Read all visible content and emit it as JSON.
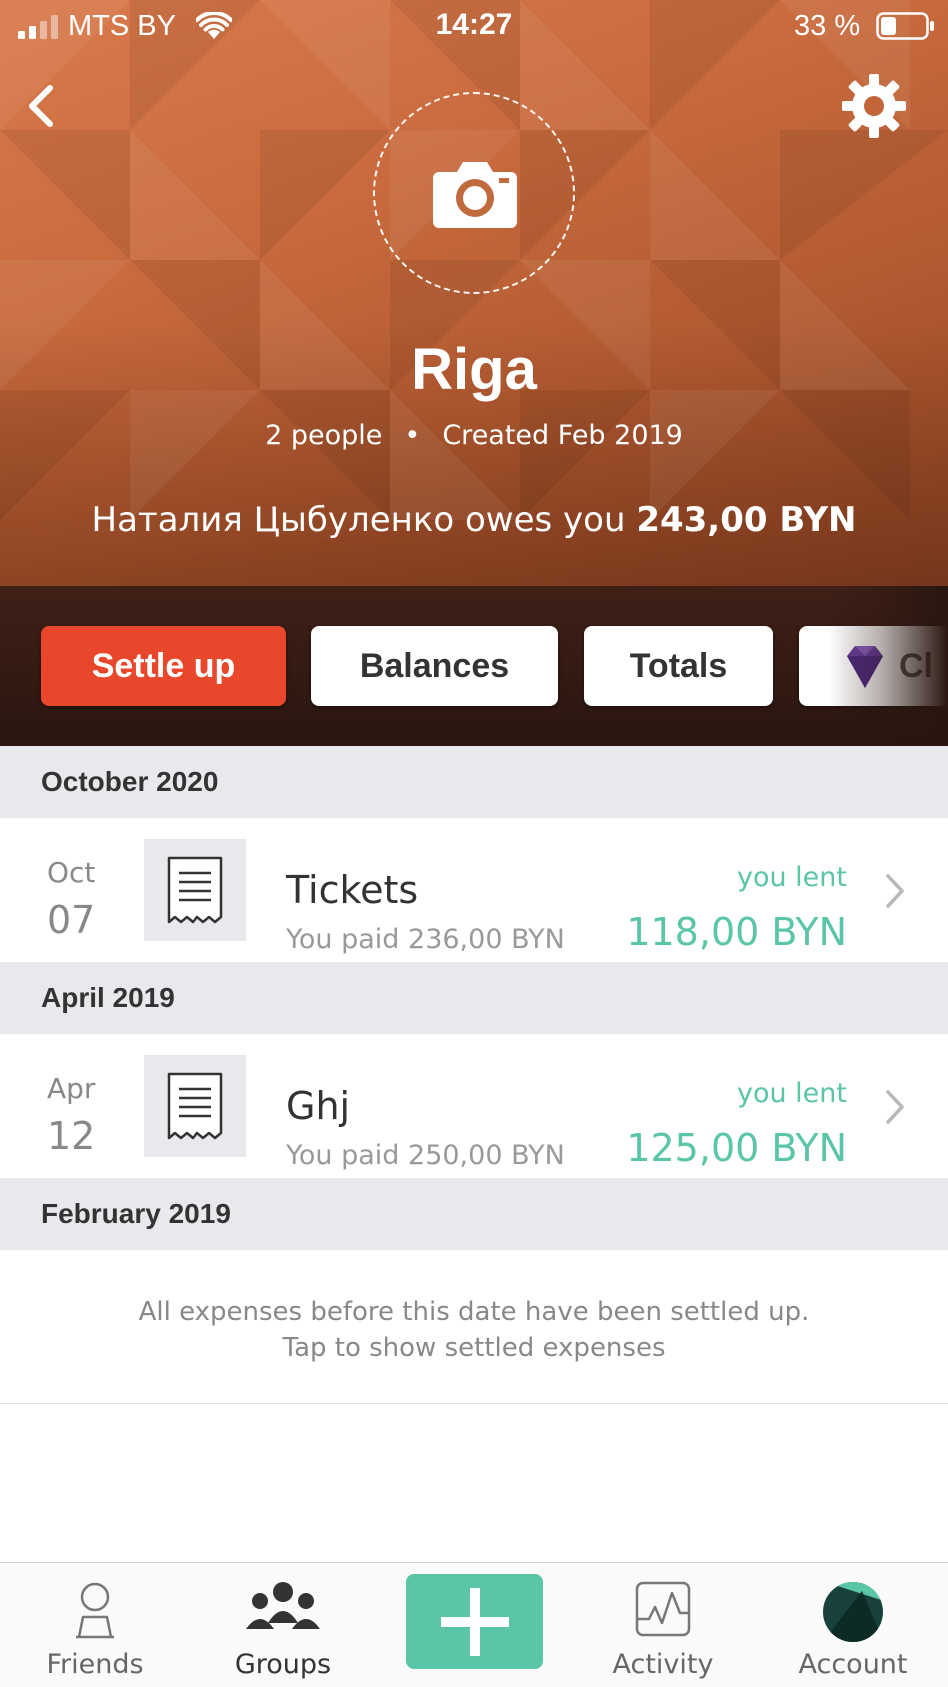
{
  "status_bar": {
    "carrier": "MTS BY",
    "time": "14:27",
    "battery_pct": "33 %"
  },
  "colors": {
    "accent": "#5bc5a7",
    "settle": "#e8472b",
    "header_bg": "#c86a3d"
  },
  "icons": [
    "back-arrow",
    "gear",
    "camera",
    "receipt",
    "chevron-right",
    "person",
    "group",
    "plus",
    "activity-chart",
    "account-avatar",
    "gem"
  ],
  "group": {
    "name": "Riga",
    "people": "2 people",
    "created": "Created Feb 2019",
    "owes_text": "Наталия Цыбуленко owes you",
    "owes_amount": "243,00 BYN"
  },
  "actions": {
    "settle_up": "Settle up",
    "balances": "Balances",
    "totals": "Totals",
    "charts": "Cl"
  },
  "sections": [
    {
      "header": "October 2020",
      "expense": {
        "month": "Oct",
        "day": "07",
        "title": "Tickets",
        "paid": "You paid 236,00 BYN",
        "lent_label": "you lent",
        "lent_amount": "118,00 BYN"
      }
    },
    {
      "header": "April 2019",
      "expense": {
        "month": "Apr",
        "day": "12",
        "title": "Ghj",
        "paid": "You paid 250,00 BYN",
        "lent_label": "you lent",
        "lent_amount": "125,00 BYN"
      }
    },
    {
      "header": "February 2019"
    }
  ],
  "settled_note": {
    "line1": "All expenses before this date have been settled up.",
    "line2": "Tap to show settled expenses"
  },
  "tabs": {
    "friends": "Friends",
    "groups": "Groups",
    "activity": "Activity",
    "account": "Account"
  }
}
